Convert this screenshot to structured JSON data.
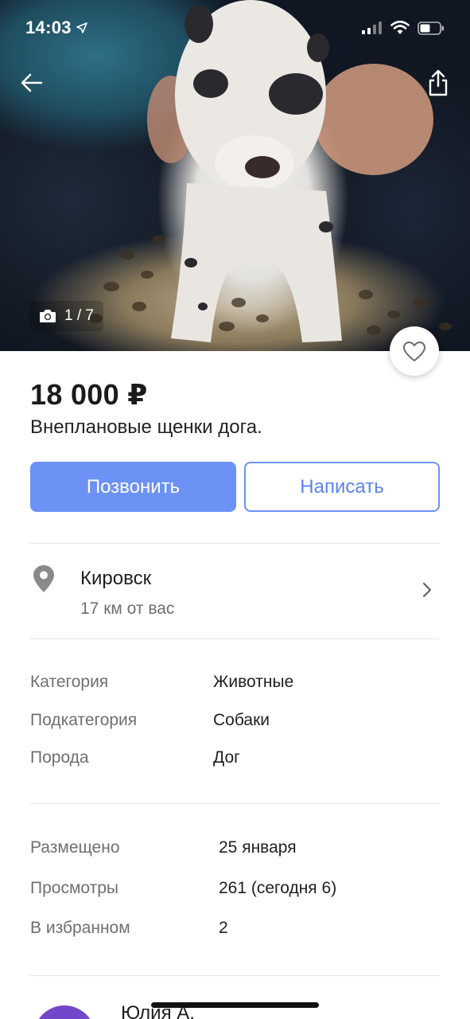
{
  "status_bar": {
    "time": "14:03",
    "icons": [
      "location-arrow-icon",
      "signal-icon",
      "wifi-icon",
      "battery-icon"
    ]
  },
  "photo": {
    "counter": "1 / 7",
    "counter_icon": "camera-icon",
    "back_icon": "back-arrow-icon",
    "share_icon": "share-icon",
    "favorite_icon": "heart-icon"
  },
  "listing": {
    "price": "18 000 ₽",
    "title": "Внеплановые щенки дога."
  },
  "actions": {
    "call_label": "Позвонить",
    "write_label": "Написать"
  },
  "location": {
    "city": "Кировск",
    "distance": "17 км от вас"
  },
  "params": [
    {
      "label": "Категория",
      "value": "Животные"
    },
    {
      "label": "Подкатегория",
      "value": "Собаки"
    },
    {
      "label": "Порода",
      "value": "Дог"
    }
  ],
  "stats": [
    {
      "label": "Размещено",
      "value": "25 января"
    },
    {
      "label": "Просмотры",
      "value": "261 (сегодня 6)"
    },
    {
      "label": "В избранном",
      "value": "2"
    }
  ],
  "seller": {
    "name": "Юлия А."
  },
  "colors": {
    "accent": "#6d92f6",
    "avatar": "#7347c9",
    "muted_text": "#6f6f6f"
  }
}
